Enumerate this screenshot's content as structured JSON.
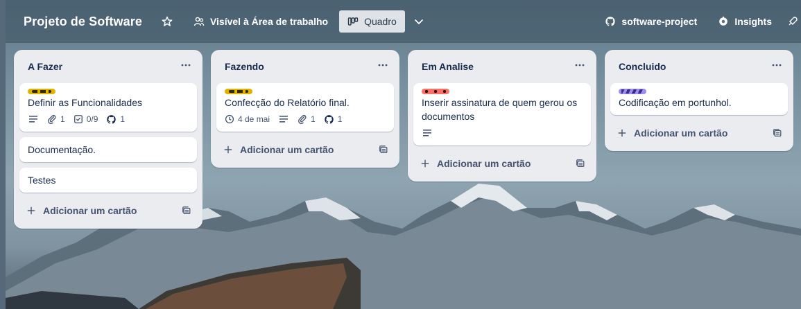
{
  "board": {
    "title": "Projeto de Software",
    "visibility_label": "Visível à Área de trabalho",
    "view_label": "Quadro",
    "github_label": "software-project",
    "insights_label": "Insights"
  },
  "lists": [
    {
      "title": "A Fazer",
      "cards": [
        {
          "labels": [
            "yellow"
          ],
          "title": "Definir as Funcionalidades",
          "badges": {
            "description": true,
            "attachments": "1",
            "checklist": "0/9",
            "github": "1"
          }
        },
        {
          "title": "Documentação."
        },
        {
          "title": "Testes"
        }
      ],
      "add_card_label": "Adicionar um cartão"
    },
    {
      "title": "Fazendo",
      "cards": [
        {
          "labels": [
            "yellow"
          ],
          "title": "Confecção do Relatório final.",
          "badges": {
            "due": "4 de mai",
            "description": true,
            "attachments": "1",
            "github": "1"
          }
        }
      ],
      "add_card_label": "Adicionar um cartão"
    },
    {
      "title": "Em Analise",
      "cards": [
        {
          "labels": [
            "red"
          ],
          "title": "Inserir assinatura de quem gerou os documentos",
          "badges": {
            "description": true
          }
        }
      ],
      "add_card_label": "Adicionar um cartão"
    },
    {
      "title": "Concluido",
      "cards": [
        {
          "labels": [
            "purple"
          ],
          "title": "Codificação em portunhol."
        }
      ],
      "add_card_label": "Adicionar um cartão"
    }
  ],
  "colors": {
    "label_yellow": "#e2b203",
    "label_red": "#f87168",
    "label_purple": "#9f8fef",
    "list_bg": "#ebecf0",
    "text": "#172b4d"
  }
}
